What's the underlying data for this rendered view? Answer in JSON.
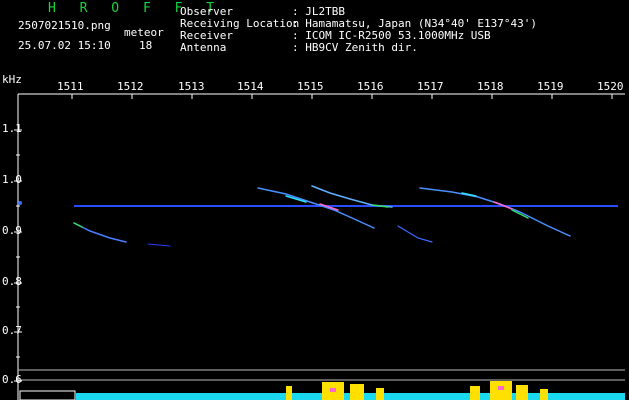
{
  "header": {
    "logo": "H R O F F T",
    "filename": "2507021510.png",
    "datetime": "25.07.02 15:10",
    "mode_label": "meteor",
    "count": "18",
    "info": [
      {
        "label": "Observer",
        "value": ": JL2TBB"
      },
      {
        "label": "Receiving Location",
        "value": ": Hamamatsu, Japan (N34°40' E137°43')"
      },
      {
        "label": "Receiver",
        "value": ": ICOM IC-R2500 53.1000MHz USB"
      },
      {
        "label": "Antenna",
        "value": ": HB9CV Zenith dir."
      }
    ]
  },
  "axis": {
    "unit": "kHz",
    "time_ticks": [
      "1511",
      "1512",
      "1513",
      "1514",
      "1515",
      "1516",
      "1517",
      "1518",
      "1519",
      "1520"
    ],
    "freq_ticks": [
      "1.1",
      "1.0",
      "0.9",
      "0.8",
      "0.7",
      "0.6"
    ]
  },
  "colors": {
    "background": "#000000",
    "logo": "#19d43a",
    "carrier": "#2a4cff",
    "trace": "#5fb0ff",
    "highlight": "#ff66cc",
    "level": "#19d8f0",
    "peak": "#ffe000"
  }
}
